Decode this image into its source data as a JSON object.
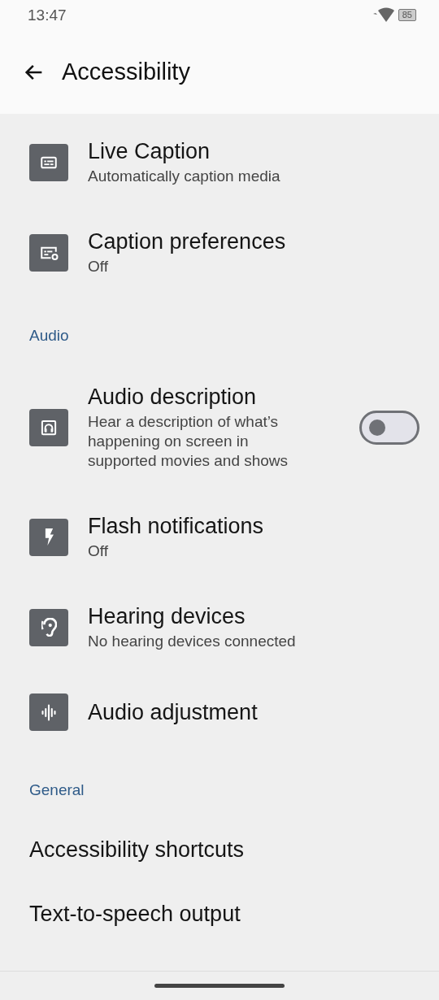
{
  "status_bar": {
    "time": "13:47",
    "battery": "85"
  },
  "app_bar": {
    "title": "Accessibility"
  },
  "sections": [
    {
      "items": [
        {
          "kind": "icon_row",
          "title": "Live Caption",
          "subtitle": "Automatically caption media"
        },
        {
          "kind": "icon_row",
          "title": "Caption preferences",
          "subtitle": "Off"
        }
      ]
    },
    {
      "header": "Audio",
      "items": [
        {
          "kind": "toggle_row",
          "title": "Audio description",
          "subtitle": "Hear a description of what’s happening on screen in supported movies and shows",
          "on": false
        },
        {
          "kind": "icon_row",
          "title": "Flash notifications",
          "subtitle": "Off"
        },
        {
          "kind": "icon_row",
          "title": "Hearing devices",
          "subtitle": "No hearing devices connected"
        },
        {
          "kind": "icon_row",
          "title": "Audio adjustment"
        }
      ]
    },
    {
      "header": "General",
      "items": [
        {
          "kind": "text_row",
          "title": "Accessibility shortcuts"
        },
        {
          "kind": "text_row",
          "title": "Text-to-speech output"
        }
      ]
    }
  ]
}
